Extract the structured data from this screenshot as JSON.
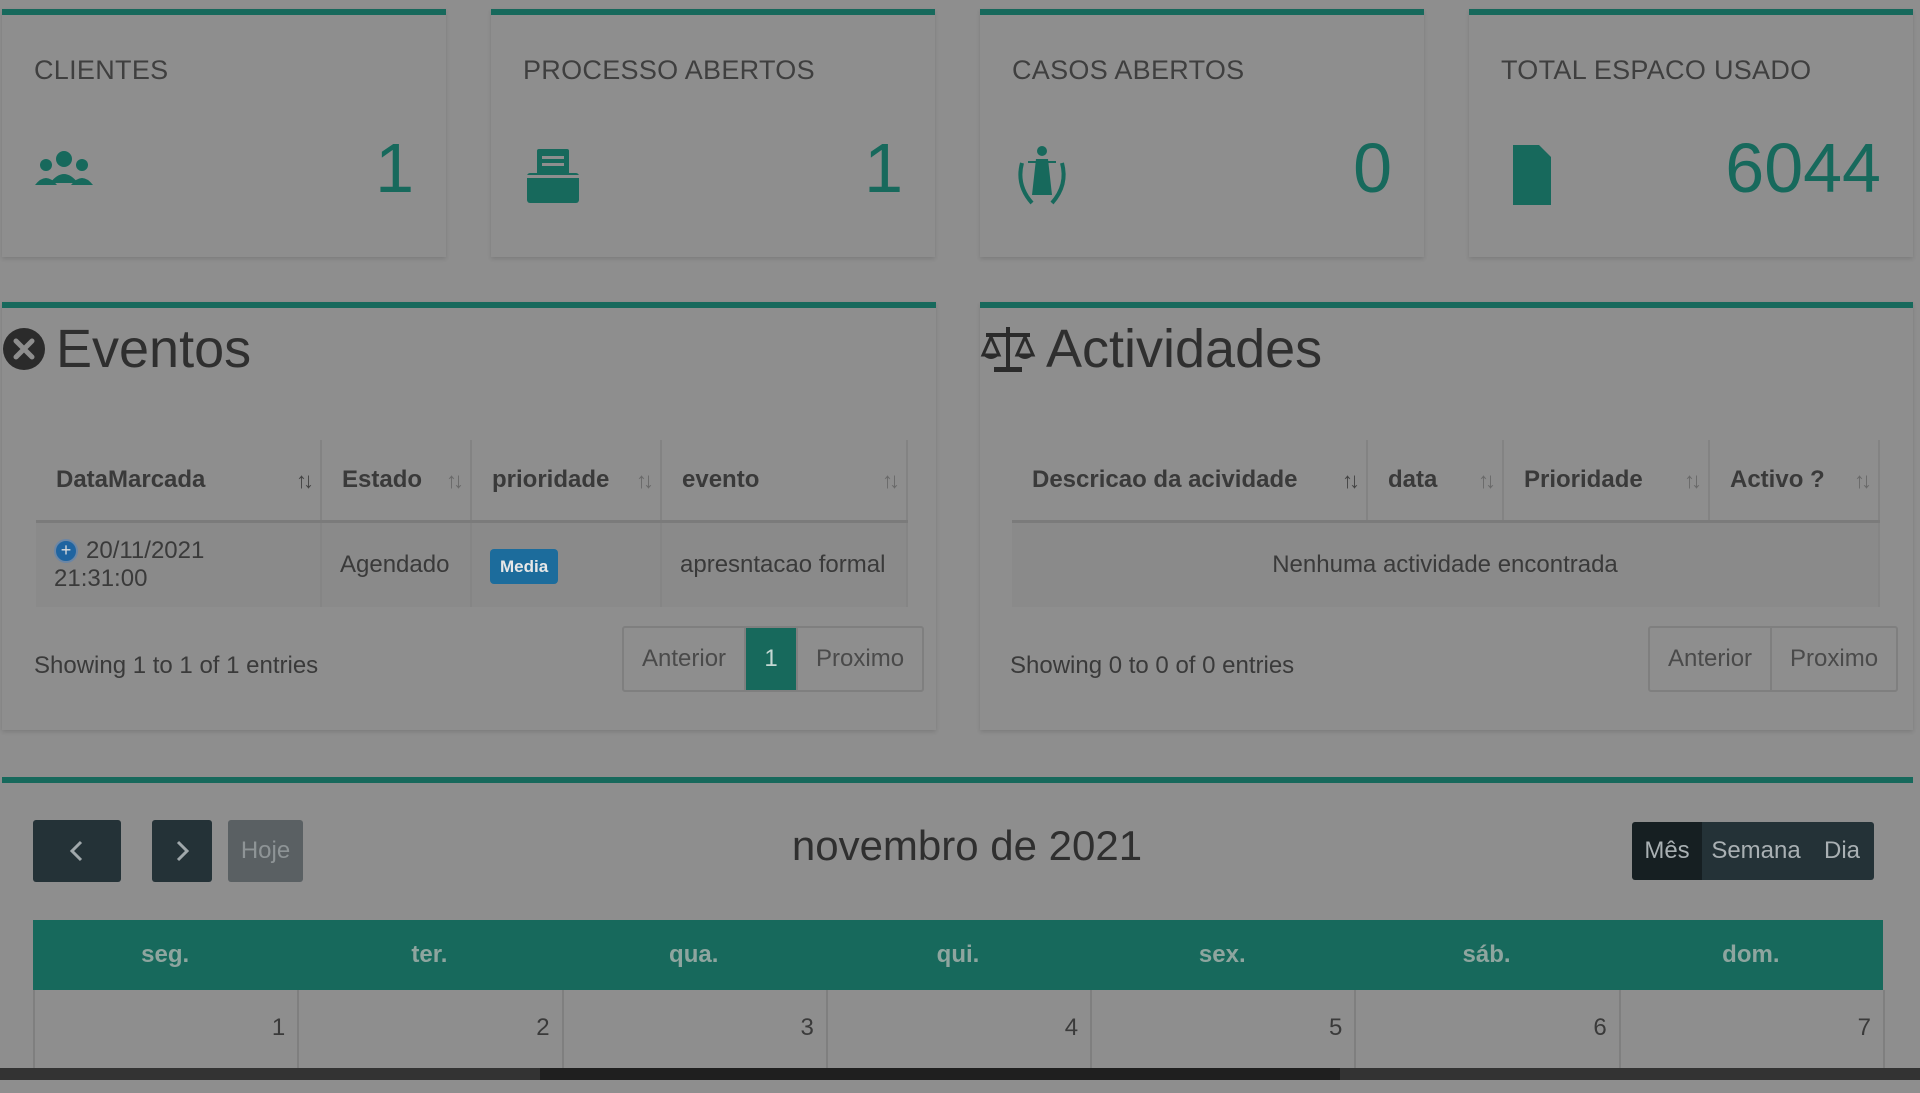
{
  "stats": [
    {
      "title": "CLIENTES",
      "value": "1",
      "icon": "users-icon"
    },
    {
      "title": "PROCESSO ABERTOS",
      "value": "1",
      "icon": "inbox-tray-icon"
    },
    {
      "title": "CASOS ABERTOS",
      "value": "0",
      "icon": "justice-statue-icon"
    },
    {
      "title": "TOTAL ESPACO USADO",
      "value": "6044",
      "icon": "file-icon"
    }
  ],
  "eventos": {
    "title": "Eventos",
    "columns": [
      "DataMarcada",
      "Estado",
      "prioridade",
      "evento"
    ],
    "rows": [
      {
        "data": "20/11/2021 21:31:00",
        "estado": "Agendado",
        "prioridade": "Media",
        "evento": "apresntacao formal"
      }
    ],
    "info": "Showing 1 to 1 of 1 entries",
    "pager": {
      "prev": "Anterior",
      "page": "1",
      "next": "Proximo"
    }
  },
  "actividades": {
    "title": "Actividades",
    "columns": [
      "Descricao da acividade",
      "data",
      "Prioridade",
      "Activo ?"
    ],
    "empty": "Nenhuma actividade encontrada",
    "info": "Showing 0 to 0 of 0 entries",
    "pager": {
      "prev": "Anterior",
      "next": "Proximo"
    }
  },
  "calendar": {
    "title": "novembro de 2021",
    "today_label": "Hoje",
    "views": [
      "Mês",
      "Semana",
      "Dia"
    ],
    "active_view": "Mês",
    "weekdays": [
      "seg.",
      "ter.",
      "qua.",
      "qui.",
      "sex.",
      "sáb.",
      "dom."
    ],
    "first_week": [
      "1",
      "2",
      "3",
      "4",
      "5",
      "6",
      "7"
    ]
  },
  "colors": {
    "accent": "#17695c",
    "badge": "#1c6c9c",
    "dark_button": "#243237"
  }
}
